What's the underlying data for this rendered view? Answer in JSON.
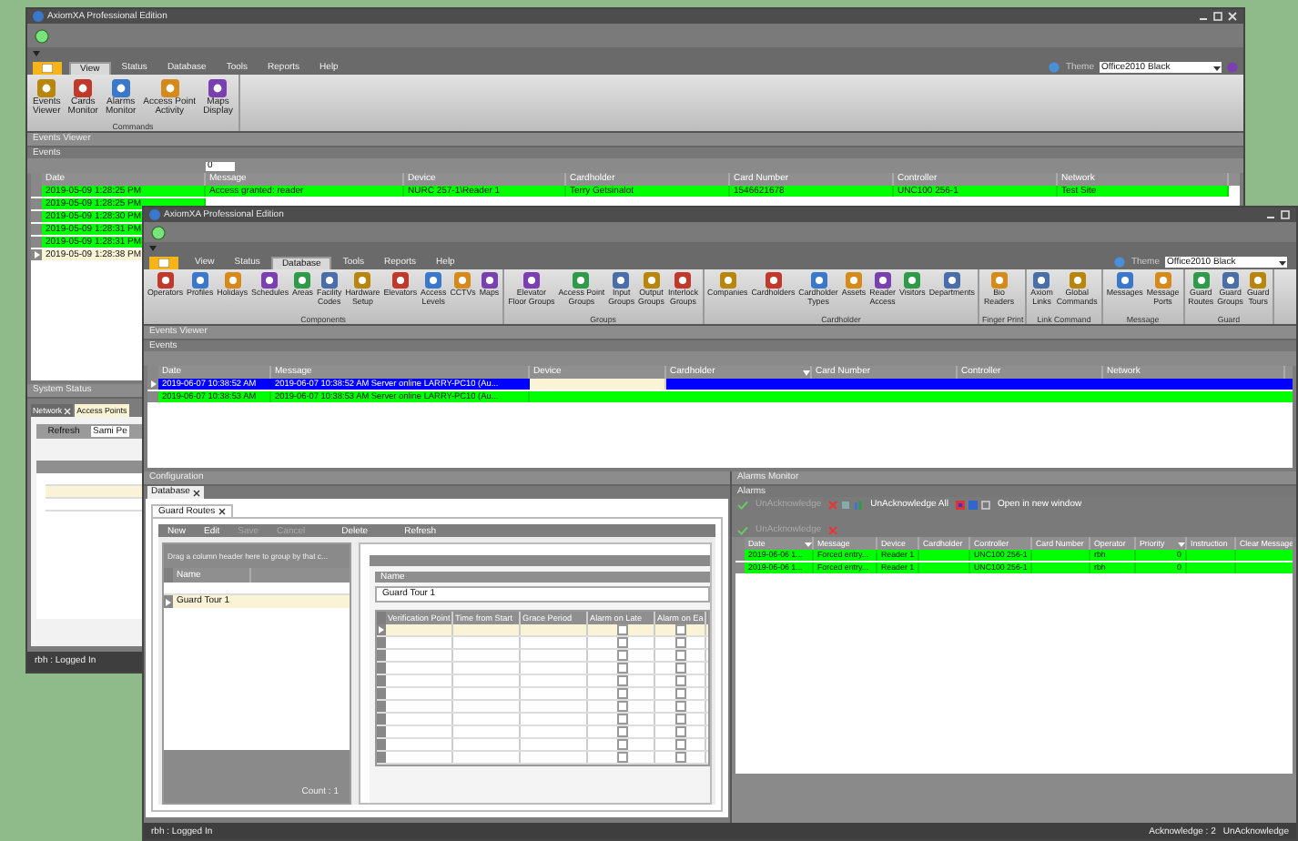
{
  "back_window": {
    "title": "AxiomXA Professional Edition",
    "tabs": [
      {
        "label": "View",
        "selected": true
      },
      {
        "label": "Status",
        "selected": false
      },
      {
        "label": "Database",
        "selected": false
      },
      {
        "label": "Tools",
        "selected": false
      },
      {
        "label": "Reports",
        "selected": false
      },
      {
        "label": "Help",
        "selected": false
      }
    ],
    "theme_label": "Theme",
    "theme": "Office2010 Black",
    "ribbon_groups": [
      {
        "label": "Commands",
        "buttons": [
          "Events\nViewer",
          "Cards\nMonitor",
          "Alarms\nMonitor",
          "Access Point\nActivity",
          "Maps\nDisplay"
        ]
      }
    ],
    "events_viewer": {
      "title": "Events Viewer",
      "section": "Events",
      "filter": "0",
      "columns": [
        "Date",
        "Message",
        "Device",
        "Cardholder",
        "Card Number",
        "Controller",
        "Network"
      ],
      "rows": [
        {
          "selected": false,
          "cells": [
            {
              "text": "2019-05-09 1:28:25 PM",
              "focused": false
            },
            {
              "text": "Access granted: reader",
              "focused": false
            },
            {
              "text": "NURC 257-1\\Reader 1",
              "focused": false
            },
            {
              "text": "Terry Getsinalot",
              "focused": false
            },
            {
              "text": "1546621678",
              "focused": false
            },
            {
              "text": "UNC100 256-1",
              "focused": false
            },
            {
              "text": "Test Site",
              "focused": false
            }
          ]
        },
        {
          "selected": false,
          "cells": [
            {
              "text": "2019-05-09 1:28:25 PM",
              "focused": false
            }
          ]
        },
        {
          "selected": false,
          "cells": [
            {
              "text": "2019-05-09 1:28:30 PM",
              "focused": false
            }
          ]
        },
        {
          "selected": false,
          "cells": [
            {
              "text": "2019-05-09 1:28:31 PM",
              "focused": false
            }
          ]
        },
        {
          "selected": false,
          "cells": [
            {
              "text": "2019-05-09 1:28:31 PM",
              "focused": false
            }
          ]
        },
        {
          "selected": true,
          "cells": [
            {
              "text": "2019-05-09 1:28:38 PM",
              "focused": true
            }
          ]
        }
      ]
    },
    "system_status": {
      "title": "System Status",
      "tabs": [
        {
          "label": "Network",
          "selected": false
        },
        {
          "label": "Access Points",
          "selected": true
        }
      ],
      "refresh": "Refresh",
      "column_2": "Sami Pe"
    },
    "status_bar": "rbh : Logged In"
  },
  "front_window": {
    "title": "AxiomXA Professional Edition",
    "tabs": [
      {
        "label": "View",
        "selected": false
      },
      {
        "label": "Status",
        "selected": false
      },
      {
        "label": "Database",
        "selected": true
      },
      {
        "label": "Tools",
        "selected": false
      },
      {
        "label": "Reports",
        "selected": false
      },
      {
        "label": "Help",
        "selected": false
      }
    ],
    "theme_label": "Theme",
    "theme": "Office2010 Black",
    "ribbon_groups": [
      {
        "label": "Components",
        "buttons": [
          "Operators",
          "Profiles",
          "Holidays",
          "Schedules",
          "Areas",
          "Facility\nCodes",
          "Hardware\nSetup",
          "Elevators",
          "Access\nLevels",
          "CCTVs",
          "Maps"
        ]
      },
      {
        "label": "Groups",
        "buttons": [
          "Elevator\nFloor Groups",
          "Access Point\nGroups",
          "Input\nGroups",
          "Output\nGroups",
          "Interlock\nGroups"
        ]
      },
      {
        "label": "Cardholder",
        "buttons": [
          "Companies",
          "Cardholders",
          "Cardholder\nTypes",
          "Assets",
          "Reader\nAccess",
          "Visitors",
          "Departments"
        ]
      },
      {
        "label": "Finger Print",
        "buttons": [
          "Bio\nReaders"
        ]
      },
      {
        "label": "Link Command",
        "buttons": [
          "Axiom\nLinks",
          "Global\nCommands"
        ]
      },
      {
        "label": "Message",
        "buttons": [
          "Messages",
          "Message\nPorts"
        ]
      },
      {
        "label": "Guard",
        "buttons": [
          "Guard\nRoutes",
          "Guard\nGroups",
          "Guard\nTours"
        ]
      }
    ],
    "events_viewer": {
      "title": "Events Viewer",
      "section": "Events",
      "columns": [
        {
          "label": "Date",
          "filtered": false
        },
        {
          "label": "Message",
          "filtered": false
        },
        {
          "label": "Device",
          "filtered": false
        },
        {
          "label": "Cardholder",
          "filtered": true
        },
        {
          "label": "Card Number",
          "filtered": false
        },
        {
          "label": "Controller",
          "filtered": false
        },
        {
          "label": "Network",
          "filtered": false
        }
      ],
      "rows": [
        {
          "selected": true,
          "cells": [
            {
              "text": "2019-06-07 10:38:52 AM",
              "focused": false
            },
            {
              "text": "2019-06-07 10:38:52 AM Server online LARRY-PC10 (Au...",
              "focused": false
            },
            {
              "focused": true
            }
          ]
        },
        {
          "selected": false,
          "cells": [
            {
              "text": "2019-06-07 10:38:53 AM",
              "focused": false
            },
            {
              "text": "2019-06-07 10:38:53 AM Server online LARRY-PC10 (Au...",
              "focused": false
            }
          ]
        }
      ]
    },
    "configuration": {
      "title": "Configuration",
      "tab": "Database",
      "inner_tab": "Guard Routes",
      "toolbar": [
        {
          "label": "New",
          "disabled": false
        },
        {
          "label": "Edit",
          "disabled": false
        },
        {
          "label": "Save",
          "disabled": true
        },
        {
          "label": "Cancel",
          "disabled": true
        },
        {
          "label": "Delete",
          "disabled": false
        },
        {
          "label": "Refresh",
          "disabled": false
        }
      ],
      "list": {
        "group_hint": "Drag a column header here to group by that c...",
        "column": "Name",
        "rows": [
          {
            "name": "Guard Tour 1",
            "selected": true
          }
        ],
        "count": "Count : 1"
      },
      "detail": {
        "name_label": "Name",
        "name_value": "Guard Tour 1",
        "columns": [
          "Verification Point",
          "Time from Start",
          "Grace Period",
          "Alarm on Late",
          "Alarm on Ea"
        ],
        "rows": [
          {
            "selected": true,
            "alarm_on_late": false,
            "alarm_on_early": false
          },
          {
            "selected": false,
            "alarm_on_late": false,
            "alarm_on_early": false
          },
          {
            "selected": false,
            "alarm_on_late": false,
            "alarm_on_early": false
          },
          {
            "selected": false,
            "alarm_on_late": false,
            "alarm_on_early": false
          },
          {
            "selected": false,
            "alarm_on_late": false,
            "alarm_on_early": false
          },
          {
            "selected": false,
            "alarm_on_late": false,
            "alarm_on_early": false
          },
          {
            "selected": false,
            "alarm_on_late": false,
            "alarm_on_early": false
          },
          {
            "selected": false,
            "alarm_on_late": false,
            "alarm_on_early": false
          },
          {
            "selected": false,
            "alarm_on_late": false,
            "alarm_on_early": false
          },
          {
            "selected": false,
            "alarm_on_late": false,
            "alarm_on_early": false
          },
          {
            "selected": false,
            "alarm_on_late": false,
            "alarm_on_early": false
          }
        ]
      }
    },
    "alarms_monitor": {
      "title": "Alarms Monitor",
      "section": "Alarms",
      "toolbar": {
        "unacknowledge": {
          "label": "UnAcknowledge",
          "disabled": true
        },
        "unacknowledge_all": "UnAcknowledge All",
        "open_new_window": "Open in new window"
      },
      "toolbar_2": {
        "label": "UnAcknowledge",
        "disabled": true
      },
      "columns": [
        {
          "label": "Date",
          "sorted": true
        },
        {
          "label": "Message",
          "sorted": false
        },
        {
          "label": "Device",
          "sorted": false
        },
        {
          "label": "Cardholder",
          "sorted": false
        },
        {
          "label": "Controller",
          "sorted": false
        },
        {
          "label": "Card Number",
          "sorted": false
        },
        {
          "label": "Operator",
          "sorted": false
        },
        {
          "label": "Priority",
          "sorted": true
        },
        {
          "label": "Instruction",
          "sorted": false
        },
        {
          "label": "Clear Message",
          "sorted": false
        }
      ],
      "rows": [
        [
          "2019-06-06 1...",
          "Forced entry...",
          "Reader 1",
          null,
          "UNC100 256-1",
          null,
          "rbh",
          "0"
        ],
        [
          "2019-06-06 1...",
          "Forced entry...",
          "Reader 1",
          null,
          "UNC100 256-1",
          null,
          "rbh",
          "0"
        ]
      ]
    },
    "status_bar": {
      "user": "rbh : Logged In",
      "acknowledge": "Acknowledge : 2",
      "unacknowledge": "UnAcknowledge"
    }
  }
}
